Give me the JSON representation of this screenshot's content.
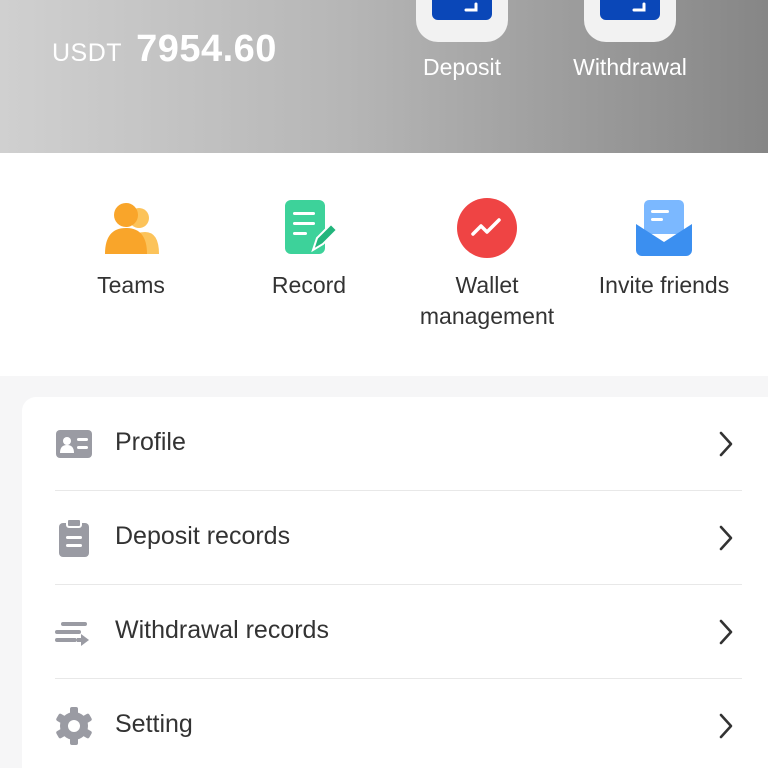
{
  "header": {
    "currency": "USDT",
    "balance": "7954.60",
    "deposit_label": "Deposit",
    "withdrawal_label": "Withdrawal",
    "gradient_colors": [
      "#d0d0d0",
      "#868686"
    ],
    "tile_icon_color": "#0a47b8"
  },
  "quick_menu": [
    {
      "label": "Teams",
      "icon": "teams-icon",
      "color": "#f9a52a"
    },
    {
      "label": "Record",
      "icon": "record-icon",
      "color": "#3dd29a"
    },
    {
      "label": "Wallet\nmanagement",
      "icon": "wallet-trend-icon",
      "color": "#ef4444"
    },
    {
      "label": "Invite friends",
      "icon": "invite-mail-icon",
      "color": "#3b8ff0"
    }
  ],
  "menu_list": [
    {
      "label": "Profile",
      "icon": "profile-card-icon"
    },
    {
      "label": "Deposit records",
      "icon": "clipboard-icon"
    },
    {
      "label": "Withdrawal records",
      "icon": "transfer-list-icon"
    },
    {
      "label": "Setting",
      "icon": "gear-icon"
    }
  ]
}
